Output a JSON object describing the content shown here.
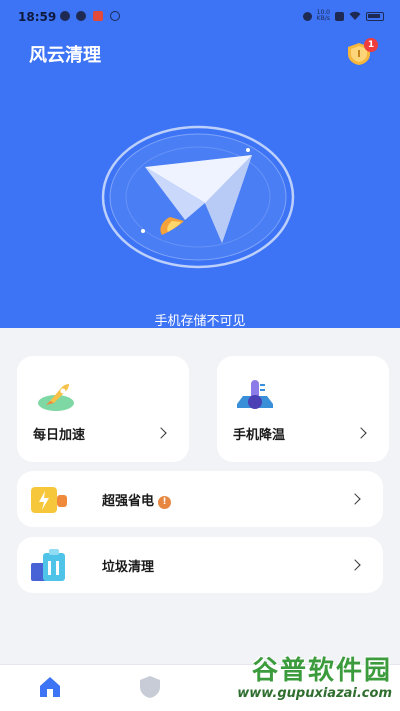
{
  "status_bar": {
    "time": "18:59",
    "net_speed_top": "10.0",
    "net_speed_bottom": "KB/s"
  },
  "header": {
    "app_title": "风云清理",
    "notification_count": "1"
  },
  "hero": {
    "storage_text": "手机存储不可见"
  },
  "cards": {
    "daily_boost": {
      "label": "每日加速"
    },
    "phone_cool": {
      "label": "手机降温"
    },
    "power_save": {
      "label": "超强省电",
      "alert": "!"
    },
    "junk_clean": {
      "label": "垃圾清理"
    }
  },
  "watermark": {
    "title": "谷普软件园",
    "url": "www.gupuxiazai.com"
  },
  "colors": {
    "hero_blue": "#3d73f5",
    "background": "#f2f3f7",
    "active_nav": "#3d73f5"
  }
}
